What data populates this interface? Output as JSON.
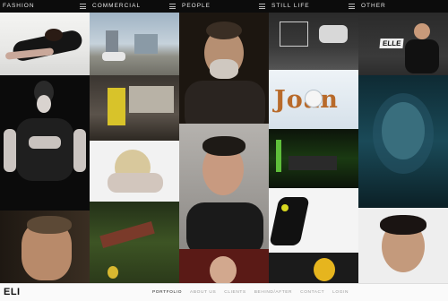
{
  "columns": [
    {
      "label": "FASHION"
    },
    {
      "label": "COMMERCIAL"
    },
    {
      "label": "PEOPLE"
    },
    {
      "label": "STILL LIFE"
    },
    {
      "label": "OTHER"
    }
  ],
  "tiles": {
    "still_life_title": "Joan",
    "other_sign": "ELLE"
  },
  "footer": {
    "logo": "ELI",
    "nav": [
      "PORTFOLIO",
      "ABOUT US",
      "CLIENTS",
      "BEHIND/AFTER",
      "CONTACT",
      "LOGIN"
    ]
  },
  "colors": {
    "header_bg": "#0c0c0c",
    "footer_bg": "#fafafa",
    "joan_brown": "#b86a2a"
  }
}
